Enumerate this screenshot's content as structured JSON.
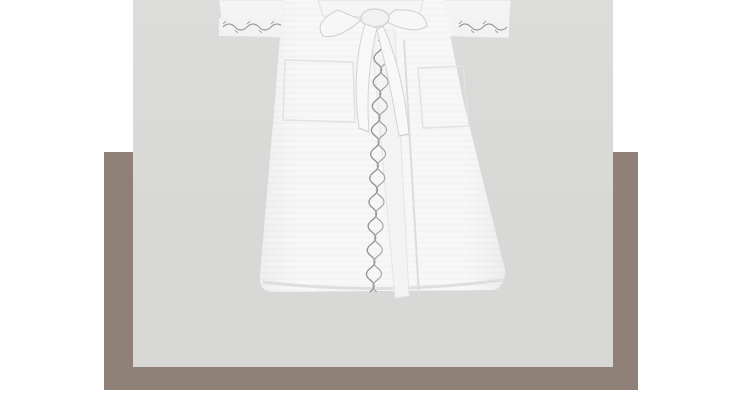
{
  "product_image": {
    "subject": "white-waffle-bathrobe",
    "colors": {
      "page_background": "#ffffff",
      "frame_brown": "#8f8178",
      "panel_gray": "#dadad8",
      "robe_white": "#f7f7f7",
      "robe_shadow": "#e3e3e3",
      "embroidery_gray": "#9a9a9a"
    }
  }
}
